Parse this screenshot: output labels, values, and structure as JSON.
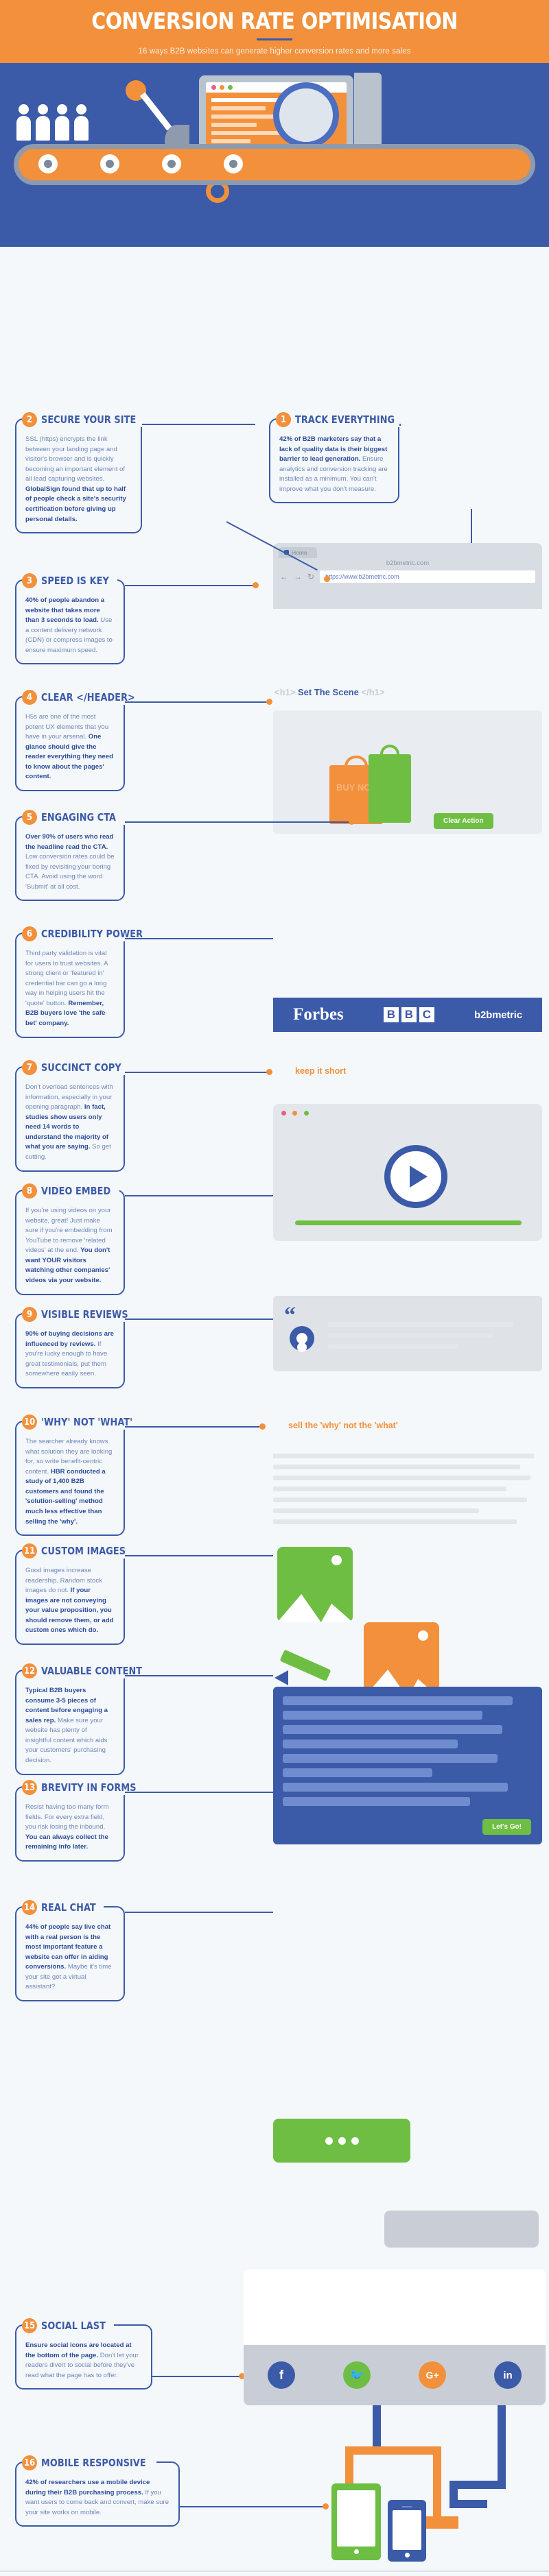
{
  "header": {
    "title": "CONVERSION RATE OPTIMISATION",
    "subtitle": "16 ways B2B websites can generate higher conversion rates and more sales"
  },
  "hero": {
    "coins": [
      "£",
      "£",
      "£"
    ]
  },
  "browser": {
    "tab_label": "Home",
    "site_chip": "b2bmetric.com",
    "url_value": "https://www.b2bmetric.com",
    "back_icon": "arrow-left-icon",
    "forward_icon": "arrow-right-icon",
    "reload_icon": "reload-icon",
    "code_badge": "<>"
  },
  "labels": {
    "set_the_scene_open": "<h1>",
    "set_the_scene_text": "Set The Scene",
    "set_the_scene_close": "</h1>",
    "clear_action": "Clear Action",
    "keep_it_short": "keep it short",
    "sell_why_not_what": "sell the 'why' not the 'what'",
    "buy_now": "BUY NOW",
    "lets_go": "Let's Go!"
  },
  "logos": {
    "forbes": "Forbes",
    "bbc": [
      "B",
      "B",
      "C"
    ],
    "b2bmetric": "b2bmetric"
  },
  "social": [
    {
      "name": "facebook",
      "glyph": "f",
      "color": "#3b5aa8"
    },
    {
      "name": "twitter",
      "glyph": "🐦",
      "color": "#6fbe44"
    },
    {
      "name": "google-plus",
      "glyph": "G+",
      "color": "#f2903c"
    },
    {
      "name": "linkedin",
      "glyph": "in",
      "color": "#3b5aa8"
    }
  ],
  "colors": {
    "orange": "#f2903c",
    "blue": "#3b5aa8",
    "green": "#6fbe44",
    "light_bg": "#f5f8fa",
    "body_text": "#6f86bb",
    "bold_text": "#2b4b9b"
  },
  "items": [
    {
      "num": "1",
      "title": "TRACK EVERYTHING",
      "bold": "42% of B2B marketers say that a lack of quality data is their biggest barrier to lead generation.",
      "rest": " Ensure analytics and conversion tracking are installed as a minimum. You can't improve what you don't measure."
    },
    {
      "num": "2",
      "title": "SECURE YOUR SITE",
      "pre": "SSL (https) encrypts the link between your landing page and visitor's browser and is quickly becoming an important element of all lead capturing websites. ",
      "bold": "GlobalSign found that up to half of people check a site's security certification before giving up personal details."
    },
    {
      "num": "3",
      "title": "SPEED IS KEY",
      "bold": "40% of people abandon a website that takes more than 3 seconds to load.",
      "rest": " Use a content delivery network (CDN) or compress images to ensure maximum speed."
    },
    {
      "num": "4",
      "title": "CLEAR </HEADER>",
      "pre": "H5s are one of the most potent UX elements that you have in your arsenal. ",
      "bold": "One glance should give the reader everything they need to know about the pages' content."
    },
    {
      "num": "5",
      "title": "ENGAGING CTA",
      "bold": "Over 90% of users who read the headline read the CTA.",
      "rest": " Low conversion rates could be fixed by revisiting your boring CTA. Avoid using the word 'Submit' at all cost."
    },
    {
      "num": "6",
      "title": "CREDIBILITY POWER",
      "pre": "Third party validation is vital for users to trust websites. A strong client or 'featured in' credential bar can go a long way in helping users hit the 'quote' button. ",
      "bold": "Remember, B2B buyers love 'the safe bet' company."
    },
    {
      "num": "7",
      "title": "SUCCINCT COPY",
      "pre": "Don't overload sentences with information, especially in your opening paragraph. ",
      "bold": "In fact, studies show users only need 14 words to understand the majority of what you are saying.",
      "rest": " So get cutting."
    },
    {
      "num": "8",
      "title": "VIDEO EMBED",
      "pre": "If you're using videos on your website, great! Just make sure if you're embedding from YouTube to remove 'related videos' at the end. ",
      "bold": "You don't want YOUR visitors watching other companies' videos via your website."
    },
    {
      "num": "9",
      "title": "VISIBLE REVIEWS",
      "bold": "90% of buying decisions are influenced by reviews.",
      "rest": " If you're lucky enough to have great testimonials, put them somewhere easily seen."
    },
    {
      "num": "10",
      "title": "'WHY' NOT 'WHAT'",
      "pre": "The searcher already knows what solution they are looking for, so write benefit-centric content. ",
      "bold": "HBR conducted a study of 1,400 B2B customers and found the 'solution-selling' method much less effective than selling the 'why'."
    },
    {
      "num": "11",
      "title": "CUSTOM IMAGES",
      "pre": "Good images increase readership. Random stock images do not. ",
      "bold": "If your images are not conveying your value proposition, you should remove them, or add custom ones which do."
    },
    {
      "num": "12",
      "title": "VALUABLE CONTENT",
      "bold": "Typical B2B buyers consume 3-5 pieces of content before engaging a sales rep.",
      "rest": " Make sure your website has plenty of insightful content which aids your customers' purchasing decision."
    },
    {
      "num": "13",
      "title": "BREVITY IN FORMS",
      "pre": "Resist having too many form fields. For every extra field, you risk losing the inbound. ",
      "bold": "You can always collect the remaining info later."
    },
    {
      "num": "14",
      "title": "REAL CHAT",
      "bold": "44% of people say live chat with a real person is the most important feature a website can offer in aiding conversions.",
      "rest": " Maybe it's time your site got a virtual assistant?"
    },
    {
      "num": "15",
      "title": "SOCIAL LAST",
      "bold": "Ensure social icons are located at the bottom of the page.",
      "rest": " Don't let your readers divert to social before they've read what the page has to offer."
    },
    {
      "num": "16",
      "title": "MOBILE RESPONSIVE",
      "bold": "42% of researchers use a mobile device during their B2B purchasing process.",
      "rest": " If you want users to come back and convert, make sure your site works on mobile."
    }
  ]
}
